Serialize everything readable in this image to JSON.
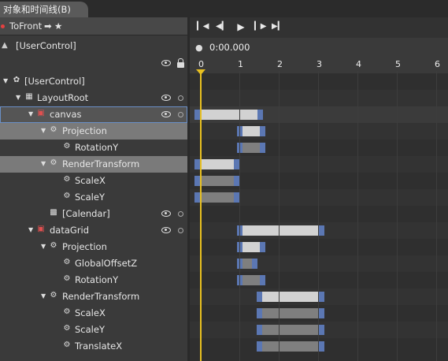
{
  "panel": {
    "title": "对象和时间线(B)"
  },
  "storyboard": {
    "name": "ToFront",
    "arrow": "➡",
    "star": "★"
  },
  "scope": {
    "label": "[UserControl]"
  },
  "transport": {
    "buttons": [
      "go-to-first-frame",
      "previous-frame",
      "play",
      "next-frame",
      "go-to-last-frame"
    ],
    "time": "0:00.000"
  },
  "ruler": {
    "ticks": [
      "0",
      "1",
      "2",
      "3",
      "4",
      "5",
      "6"
    ]
  },
  "tree": [
    {
      "label": "[UserControl]",
      "icon": "usercontrol-icon"
    },
    {
      "label": "LayoutRoot",
      "icon": "grid-icon"
    },
    {
      "label": "canvas",
      "icon": "element-animated-icon"
    },
    {
      "label": "Projection",
      "icon": "gear-icon"
    },
    {
      "label": "RotationY",
      "icon": "gear-icon"
    },
    {
      "label": "RenderTransform",
      "icon": "gear-icon"
    },
    {
      "label": "ScaleX",
      "icon": "gear-icon"
    },
    {
      "label": "ScaleY",
      "icon": "gear-icon"
    },
    {
      "label": "[Calendar]",
      "icon": "calendar-icon"
    },
    {
      "label": "dataGrid",
      "icon": "element-animated-icon"
    },
    {
      "label": "Projection",
      "icon": "gear-icon"
    },
    {
      "label": "GlobalOffsetZ",
      "icon": "gear-icon"
    },
    {
      "label": "RotationY",
      "icon": "gear-icon"
    },
    {
      "label": "RenderTransform",
      "icon": "gear-icon"
    },
    {
      "label": "ScaleX",
      "icon": "gear-icon"
    },
    {
      "label": "ScaleY",
      "icon": "gear-icon"
    },
    {
      "label": "TranslateX",
      "icon": "gear-icon"
    }
  ],
  "colors": {
    "keyframe": "#5b77b3",
    "playhead": "#e8c020",
    "bar": "#d2d2d2",
    "bar_dim": "#7f7f7f"
  },
  "keyframes": [
    null,
    null,
    {
      "start": 0,
      "end": 1.6,
      "dim": false
    },
    {
      "start": 1.0,
      "end": 1.6,
      "dim": false
    },
    {
      "start": 1.0,
      "end": 1.6,
      "dim": true
    },
    {
      "start": 0,
      "end": 1.0,
      "dim": false
    },
    {
      "start": 0,
      "end": 1.0,
      "dim": true
    },
    {
      "start": 0,
      "end": 1.0,
      "dim": true
    },
    null,
    {
      "start": 1.0,
      "end": 3.1,
      "dim": false
    },
    {
      "start": 1.0,
      "end": 1.6,
      "dim": false
    },
    {
      "start": 1.0,
      "end": 1.4,
      "dim": true
    },
    {
      "start": 1.0,
      "end": 1.6,
      "dim": true
    },
    {
      "start": 1.5,
      "end": 3.1,
      "dim": false
    },
    {
      "start": 1.5,
      "end": 3.1,
      "dim": true
    },
    {
      "start": 1.5,
      "end": 3.1,
      "dim": true
    },
    {
      "start": 1.5,
      "end": 3.1,
      "dim": true
    }
  ]
}
